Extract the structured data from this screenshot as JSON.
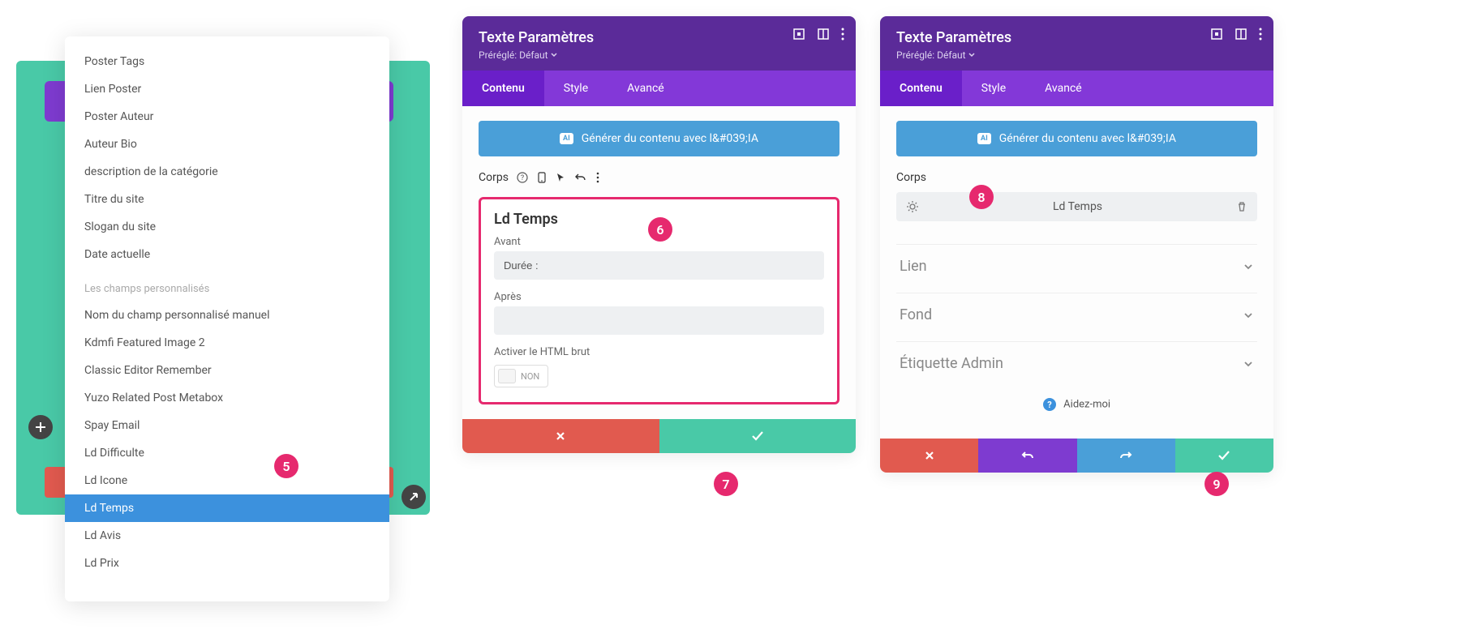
{
  "dropdown": {
    "items_top": [
      "Poster Tags",
      "Lien Poster",
      "Poster Auteur",
      "Auteur Bio",
      "description de la catégorie",
      "Titre du site",
      "Slogan du site",
      "Date actuelle"
    ],
    "section_label": "Les champs personnalisés",
    "items_bottom": [
      "Nom du champ personnalisé manuel",
      "Kdmfi Featured Image 2",
      "Classic Editor Remember",
      "Yuzo Related Post Metabox",
      "Spay Email",
      "Ld Difficulte",
      "Ld Icone",
      "Ld Temps",
      "Ld Avis",
      "Ld Prix"
    ],
    "selected": "Ld Temps"
  },
  "badges": {
    "b5": "5",
    "b6": "6",
    "b7": "7",
    "b8": "8",
    "b9": "9"
  },
  "panel2": {
    "title": "Texte Paramètres",
    "preset": "Préréglé: Défaut",
    "tabs": {
      "content": "Contenu",
      "style": "Style",
      "advanced": "Avancé"
    },
    "generate": "Générer du contenu avec l&#039;IA",
    "ai_badge": "AI",
    "corps": "Corps",
    "box_title": "Ld Temps",
    "before_label": "Avant",
    "before_value": "Durée :",
    "after_label": "Après",
    "after_value": "",
    "raw_label": "Activer le HTML brut",
    "toggle_no": "NON"
  },
  "panel3": {
    "title": "Texte Paramètres",
    "preset": "Préréglé: Défaut",
    "tabs": {
      "content": "Contenu",
      "style": "Style",
      "advanced": "Avancé"
    },
    "generate": "Générer du contenu avec l&#039;IA",
    "ai_badge": "AI",
    "corps": "Corps",
    "block_label": "Ld Temps",
    "acc1": "Lien",
    "acc2": "Fond",
    "acc3": "Étiquette Admin",
    "help": "Aidez-moi"
  }
}
